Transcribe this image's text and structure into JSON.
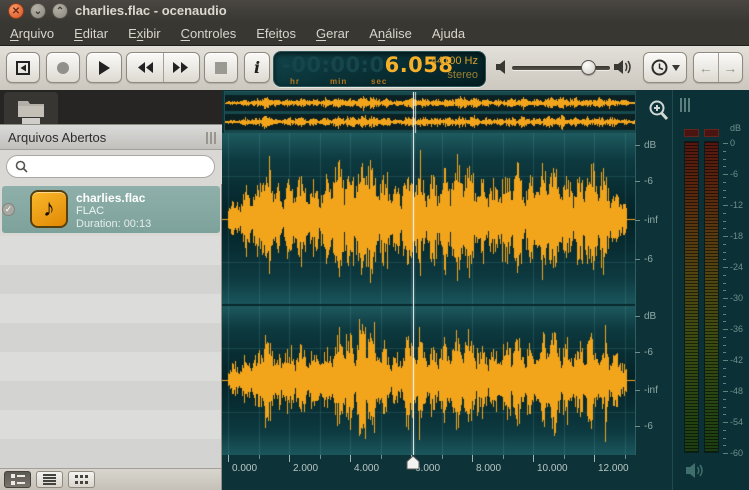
{
  "window": {
    "title": "charlies.flac - ocenaudio",
    "close_glyph": "✕",
    "minimize_glyph": "⌄",
    "maximize_glyph": "⌃"
  },
  "menu": {
    "items": [
      {
        "label": "Arquivo",
        "underline": 0
      },
      {
        "label": "Editar",
        "underline": 0
      },
      {
        "label": "Exibir",
        "underline": 1
      },
      {
        "label": "Controles",
        "underline": 0
      },
      {
        "label": "Efeitos",
        "underline": 4
      },
      {
        "label": "Gerar",
        "underline": 0
      },
      {
        "label": "Análise",
        "underline": 1
      },
      {
        "label": "Ajuda",
        "underline": -1
      }
    ]
  },
  "toolbar": {
    "info_label": "i",
    "volume": {
      "level_percent": 78
    }
  },
  "time_display": {
    "dim_digits": "-00:00:0",
    "bright_digits": "6.058",
    "unit_hr": "hr",
    "unit_min": "min",
    "unit_sec": "sec",
    "sample_rate": "44100 Hz",
    "channel_mode": "stereo"
  },
  "sidebar": {
    "panel_title": "Arquivos Abertos",
    "search": {
      "value": "",
      "placeholder": ""
    },
    "files": [
      {
        "name": "charlies.flac",
        "format": "FLAC",
        "duration": "Duration: 00:13",
        "selected": true,
        "check_glyph": "✓",
        "icon_glyph": "♪"
      }
    ]
  },
  "editor": {
    "time_axis_labels": [
      "0.000",
      "2.000",
      "4.000",
      "6.000",
      "8.000",
      "10.000",
      "12.000"
    ],
    "db_axis_labels": [
      "dB",
      "-6",
      "-inf",
      "-6"
    ],
    "playhead_seconds": 6.058
  },
  "meters": {
    "unit_label": "dB",
    "scale_labels": [
      "0",
      "-6",
      "-12",
      "-18",
      "-24",
      "-30",
      "-36",
      "-42",
      "-48",
      "-54",
      "-60"
    ]
  },
  "colors": {
    "waveform_orange": "#f2a41b",
    "teal_background": "#0d3338",
    "selection_teal": "#86a8a2",
    "lcd_bright": "#f7b02a"
  }
}
